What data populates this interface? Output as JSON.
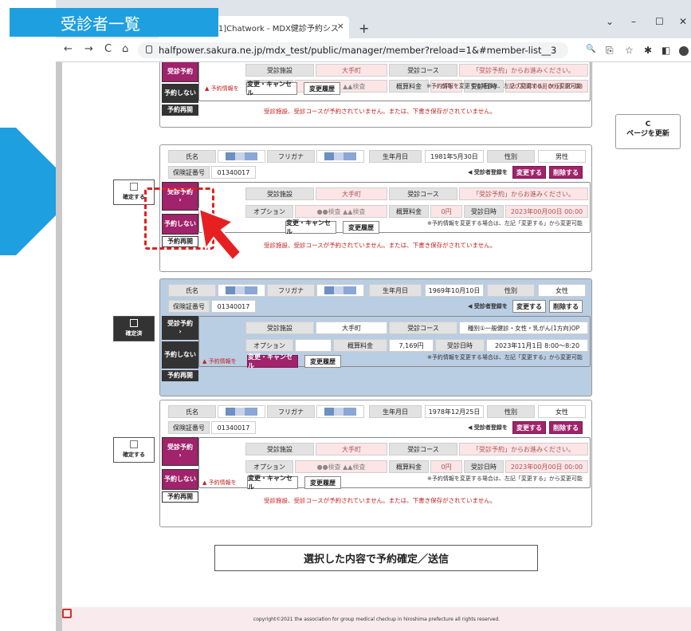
{
  "banner": "受診者一覧",
  "browser": {
    "tab_title": "[1]Chatwork - MDX健診予約シス",
    "tab_close": "×",
    "new_tab": "+",
    "url": "halfpower.sakura.ne.jp/mdx_test/public/manager/member?reload=1&#member-list__3",
    "win": [
      "⌄",
      "–",
      "☐",
      "✕"
    ],
    "nav": [
      "←",
      "→",
      "C",
      "⌂"
    ]
  },
  "page": {
    "refresh_icon": "C",
    "refresh_label": "ページを更新",
    "labels": {
      "name": "氏名",
      "kana": "フリガナ",
      "birth": "生年月日",
      "sex": "性別",
      "ins": "保険証番号",
      "facility": "受診施設",
      "course": "受診コース",
      "option": "オプション",
      "fee": "概算料金",
      "date": "受診日時",
      "reg": "◀ 受診者登録を",
      "change": "変更する",
      "delete": "削除する",
      "info": "▲ 予約情報を",
      "modify": "変更・キャンセル",
      "history": "変更履歴",
      "note": "※予約情報を変更する場合は、左記「変更する」から変更可能",
      "warn": "受診施設、受診コースが予約されていません。または、下書き保存がされていません。",
      "confirm": "確定する",
      "confirmed": "確定済",
      "reserve": "受診予約",
      "reserve_arrow": "›",
      "noreserve": "予約しない",
      "resume": "予約再開",
      "opt_tests": "●●検査 ▲▲検査",
      "fee_zero": "0円",
      "date_blank": "2023年00月00日 00:00",
      "course_hint": "「受診予約」からお進みください。",
      "facility_val": "大手町"
    },
    "cards": [
      {
        "birth": "1981年5月30日",
        "sex": "男性",
        "ins": "01340017"
      },
      {
        "birth": "1969年10月10日",
        "sex": "女性",
        "ins": "01340017",
        "facility": "大手町",
        "course": "種別①一般健診・女性・乳がん(1方向)OP",
        "fee": "7,169円",
        "date": "2023年11月1日 8:00〜8:20"
      },
      {
        "birth": "1978年12月25日",
        "sex": "女性",
        "ins": "01340017"
      }
    ],
    "submit": "選択した内容で予約確定／送信",
    "footer": "copyright©2021 the association for group medical checkup in hiroshima prefecture all rights reserved."
  }
}
